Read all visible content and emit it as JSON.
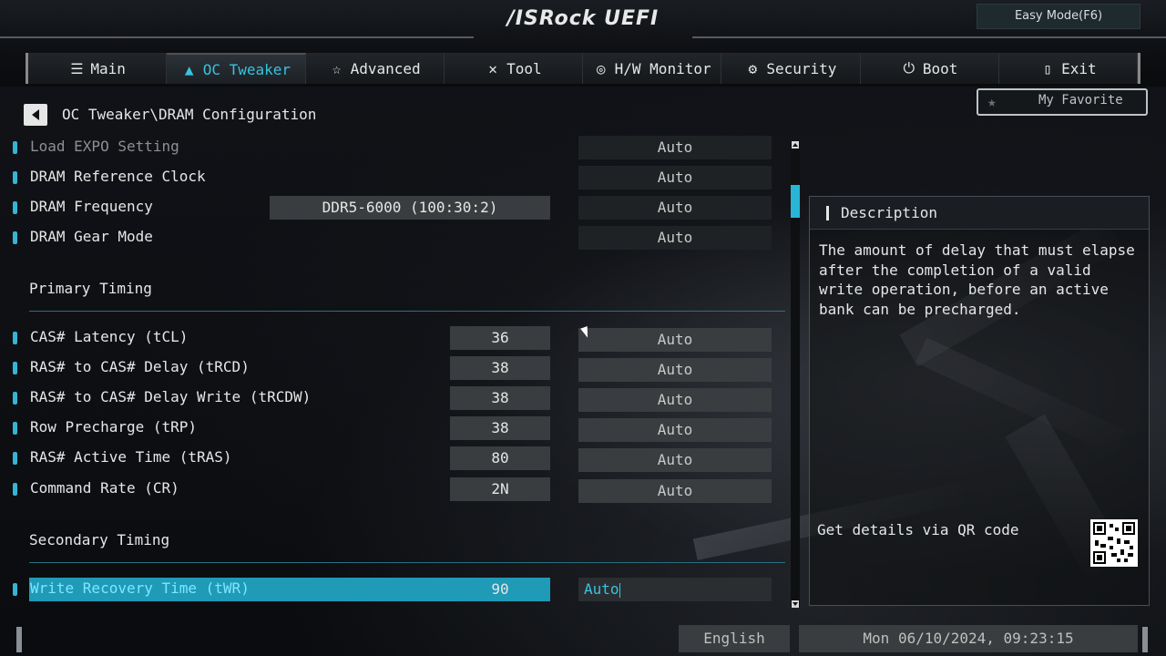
{
  "header": {
    "logo": "/ISRock UEFI",
    "easy_mode": "Easy Mode(F6)"
  },
  "tabs": [
    {
      "label": "Main",
      "icon": "list-icon",
      "active": false
    },
    {
      "label": "OC Tweaker",
      "icon": "rocket-icon",
      "active": true
    },
    {
      "label": "Advanced",
      "icon": "star-icon",
      "active": false
    },
    {
      "label": "Tool",
      "icon": "tools-icon",
      "active": false
    },
    {
      "label": "H/W Monitor",
      "icon": "monitor-icon",
      "active": false
    },
    {
      "label": "Security",
      "icon": "shield-icon",
      "active": false
    },
    {
      "label": "Boot",
      "icon": "power-icon",
      "active": false
    },
    {
      "label": "Exit",
      "icon": "exit-icon",
      "active": false
    }
  ],
  "breadcrumb": "OC Tweaker\\DRAM Configuration",
  "favorite": "My Favorite",
  "settings_top": [
    {
      "label": "Load EXPO Setting",
      "current": "",
      "value": "Auto",
      "dim": true
    },
    {
      "label": "DRAM Reference Clock",
      "current": "",
      "value": "Auto",
      "dim": false
    },
    {
      "label": "DRAM Frequency",
      "current": "DDR5-6000 (100:30:2)",
      "value": "Auto",
      "dim": false
    },
    {
      "label": "DRAM Gear Mode",
      "current": "",
      "value": "Auto",
      "dim": false
    }
  ],
  "section_primary": "Primary Timing",
  "primary": [
    {
      "label": "CAS# Latency (tCL)",
      "current": "36",
      "value": "Auto"
    },
    {
      "label": "RAS# to CAS# Delay (tRCD)",
      "current": "38",
      "value": "Auto"
    },
    {
      "label": "RAS# to CAS# Delay Write (tRCDW)",
      "current": "38",
      "value": "Auto"
    },
    {
      "label": "Row Precharge (tRP)",
      "current": "38",
      "value": "Auto"
    },
    {
      "label": "RAS# Active Time (tRAS)",
      "current": "80",
      "value": "Auto"
    },
    {
      "label": "Command Rate (CR)",
      "current": "2N",
      "value": "Auto"
    }
  ],
  "section_secondary": "Secondary Timing",
  "secondary": [
    {
      "label": "Write Recovery Time (tWR)",
      "current": "90",
      "value": "Auto",
      "selected": true
    }
  ],
  "description": {
    "title": "Description",
    "text": "The amount of delay that must elapse after the completion of a valid write operation, before an active bank can be precharged.",
    "qr_label": "Get details via QR code"
  },
  "footer": {
    "language": "English",
    "datetime": "Mon 06/10/2024, 09:23:15"
  },
  "colors": {
    "accent": "#36c4e0",
    "selected_row": "#1f9ab7"
  }
}
